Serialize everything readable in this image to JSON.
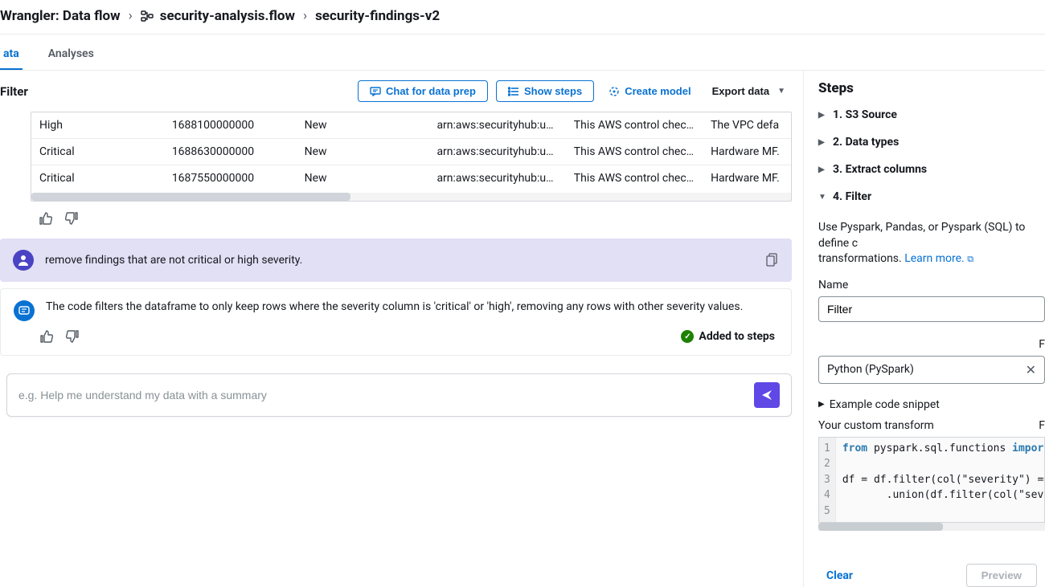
{
  "breadcrumb": {
    "root": "Wrangler: Data flow",
    "flow": "security-analysis.flow",
    "node": "security-findings-v2"
  },
  "tabs": {
    "data": "ata",
    "analyses": "Analyses"
  },
  "toolbar": {
    "title": "Filter",
    "chat": "Chat for data prep",
    "show_steps": "Show steps",
    "create_model": "Create model",
    "export": "Export data"
  },
  "table": {
    "rows": [
      {
        "severity": "High",
        "time": "1688100000000",
        "state": "New",
        "aid": "arn:aws:securityhub:us…",
        "desc": "This AWS control chec…",
        "title": "The VPC defa"
      },
      {
        "severity": "Critical",
        "time": "1688630000000",
        "state": "New",
        "aid": "arn:aws:securityhub:us…",
        "desc": "This AWS control chec…",
        "title": "Hardware MF."
      },
      {
        "severity": "Critical",
        "time": "1687550000000",
        "state": "New",
        "aid": "arn:aws:securityhub:us…",
        "desc": "This AWS control chec…",
        "title": "Hardware MF."
      }
    ]
  },
  "chat": {
    "user_msg": "remove findings that are not critical or high severity.",
    "assist_msg": "The code filters the dataframe to only keep rows where the severity column is 'critical' or 'high', removing any rows with other severity values.",
    "added": "Added to steps",
    "placeholder": "e.g. Help me understand my data with a summary"
  },
  "steps_panel": {
    "title": "Steps",
    "items": [
      {
        "label": "1. S3 Source",
        "open": false
      },
      {
        "label": "2. Data types",
        "open": false
      },
      {
        "label": "3. Extract columns",
        "open": false
      },
      {
        "label": "4. Filter",
        "open": true
      }
    ],
    "filter": {
      "desc_pre": "Use Pyspark, Pandas, or Pyspark (SQL) to define c",
      "desc_post": "transformations. ",
      "learn_more": "Learn more.",
      "name_label": "Name",
      "name_value": "Filter",
      "lang_value": "Python (PySpark)",
      "snippet_toggle": "Example code snippet",
      "transform_label": "Your custom transform",
      "right_hint": "F",
      "code_lines": [
        "from pyspark.sql.functions import",
        "",
        "df = df.filter(col(\"severity\") ==",
        "       .union(df.filter(col(\"seve",
        ""
      ]
    },
    "footer": {
      "clear": "Clear",
      "preview": "Preview"
    }
  }
}
